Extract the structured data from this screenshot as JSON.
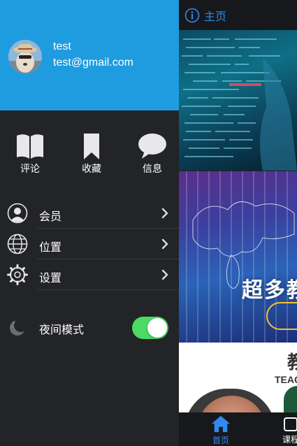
{
  "topbar": {
    "title": "主页",
    "icon": "info-icon"
  },
  "banner2": {
    "headline": "超多教"
  },
  "section": {
    "title": "教",
    "subtitle": "TEAC"
  },
  "tabbar": {
    "home_label": "首页",
    "course_label": "课程"
  },
  "drawer": {
    "user": {
      "name": "test",
      "email": "test@gmail.com"
    },
    "quick_actions": [
      {
        "label": "评论",
        "icon": "book-icon"
      },
      {
        "label": "收藏",
        "icon": "bookmark-icon"
      },
      {
        "label": "信息",
        "icon": "chat-bubble-icon"
      }
    ],
    "menu": [
      {
        "label": "会员",
        "icon": "user-icon"
      },
      {
        "label": "位置",
        "icon": "globe-icon"
      },
      {
        "label": "设置",
        "icon": "gear-icon"
      }
    ],
    "night_mode": {
      "label": "夜间模式",
      "enabled": true
    }
  },
  "colors": {
    "header_blue": "#1f9ce0",
    "accent_blue": "#2f8bf0",
    "toggle_green": "#4cd964",
    "drawer_bg": "#232427"
  }
}
